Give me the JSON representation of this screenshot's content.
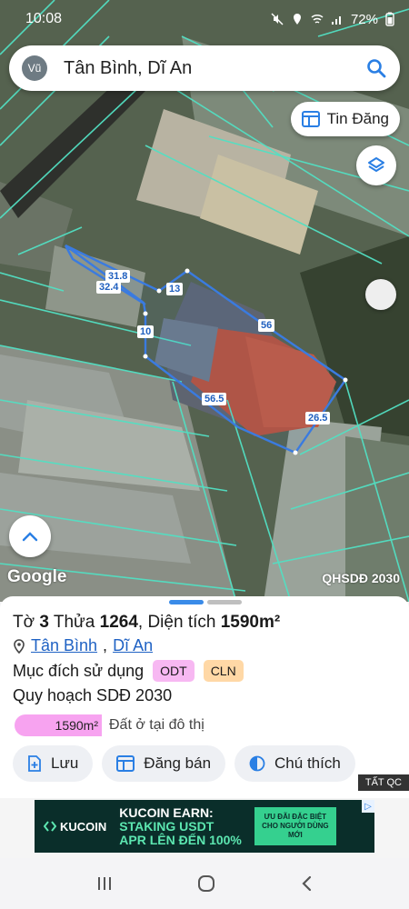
{
  "status_bar": {
    "time": "10:08",
    "battery": "72%"
  },
  "search": {
    "avatar": "Vũ",
    "query": "Tân Bình, Dĩ An"
  },
  "map": {
    "tin_dang_label": "Tin Đăng",
    "google_logo": "Google",
    "layer_label": "QHSDĐ 2030",
    "dimensions": [
      "31.8",
      "32.4",
      "13",
      "10",
      "56",
      "56.5",
      "26.5"
    ]
  },
  "panel": {
    "title_prefix": "Tờ ",
    "sheet": "3",
    "title_mid": " Thửa ",
    "parcel": "1264",
    "title_area_label": ", Diện tích ",
    "area": "1590m²",
    "ward": "Tân Bình",
    "separator": ", ",
    "city": "Dĩ An",
    "purpose_label": "Mục đích sử dụng",
    "tag_odt": "ODT",
    "tag_cln": "CLN",
    "plan_label": "Quy hoạch SDĐ 2030",
    "plan_area": "1590m²",
    "plan_desc": "Đất ở tại đô thị"
  },
  "actions": {
    "save": "Lưu",
    "post": "Đăng bán",
    "legend": "Chú thích"
  },
  "ad": {
    "tat_qc": "TẤT QC",
    "brand": "KUCOIN",
    "line1": "KUCOIN EARN:",
    "line2": "STAKING USDT",
    "line3": "APR LÊN ĐẾN 100%",
    "cta": "ƯU ĐÃI ĐẶC BIỆT CHO NGƯỜI DÙNG MỚI"
  },
  "colors": {
    "accent": "#1f62c4",
    "parcel_outline": "#3a7be0",
    "roof": "#b9523a",
    "odt": "#f7b8f2",
    "cln": "#ffd8a6"
  }
}
